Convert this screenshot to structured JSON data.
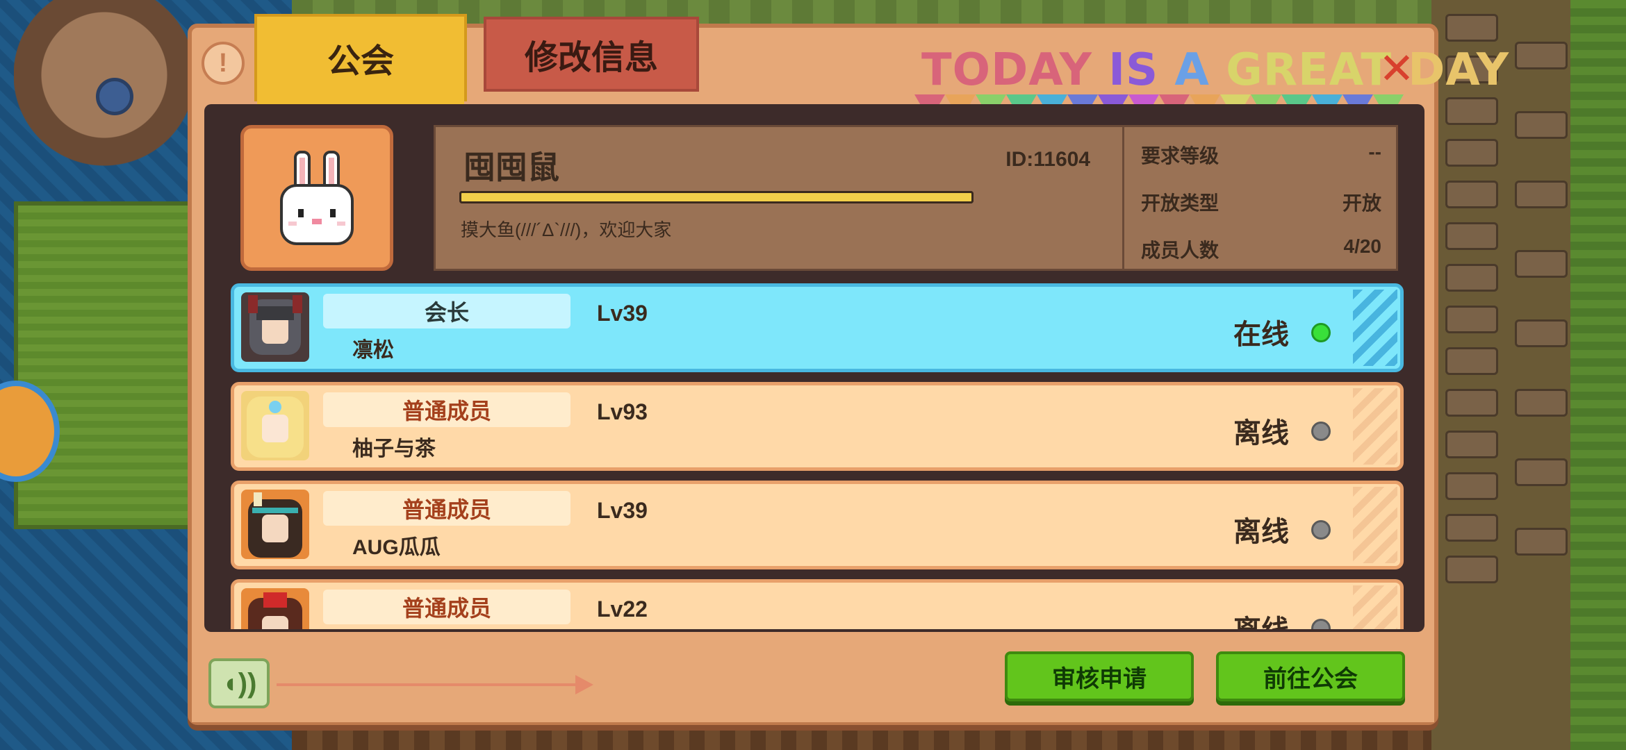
{
  "header": {
    "help_icon": "exclamation-icon",
    "tabs": [
      {
        "label": "公会",
        "active": true
      },
      {
        "label": "修改信息",
        "active": false
      }
    ],
    "banner_words": [
      {
        "text": "TODAY",
        "color": "#d8647a"
      },
      {
        "text": "IS",
        "color": "#8a5ad8"
      },
      {
        "text": "A",
        "color": "#6aa0e6"
      },
      {
        "text": "GREAT",
        "color": "#d8d46a"
      },
      {
        "text": "DAY",
        "color": "#e8c46a"
      }
    ],
    "close_icon": "close-x-icon"
  },
  "guild": {
    "emblem": "white-rabbit",
    "name": "囤囤鼠",
    "id_text": "ID:11604",
    "progress": 1.0,
    "description": "摸大鱼(///´Δ`///)，欢迎大家",
    "stats": [
      {
        "label": "要求等级",
        "value": "--"
      },
      {
        "label": "开放类型",
        "value": "开放"
      },
      {
        "label": "成员人数",
        "value": "4/20"
      }
    ]
  },
  "members": [
    {
      "role": "会长",
      "level": "Lv39",
      "name": "凛松",
      "status": "在线",
      "online": true,
      "avatar_color": "#4a3a3a"
    },
    {
      "role": "普通成员",
      "level": "Lv93",
      "name": "柚子与茶",
      "status": "离线",
      "online": false,
      "avatar_color": "#f2d27a"
    },
    {
      "role": "普通成员",
      "level": "Lv39",
      "name": "AUG瓜瓜",
      "status": "离线",
      "online": false,
      "avatar_color": "#4a2e22"
    },
    {
      "role": "普通成员",
      "level": "Lv22",
      "name": "",
      "status": "离线",
      "online": false,
      "avatar_color": "#c8302a"
    }
  ],
  "footer": {
    "sound_icon": "speaker-icon",
    "review_button": "审核申请",
    "goto_button": "前往公会"
  },
  "colors": {
    "accent": "#f1bd33",
    "online": "#39e03a",
    "offline": "#8a8a8a",
    "button_green": "#62c51c"
  }
}
